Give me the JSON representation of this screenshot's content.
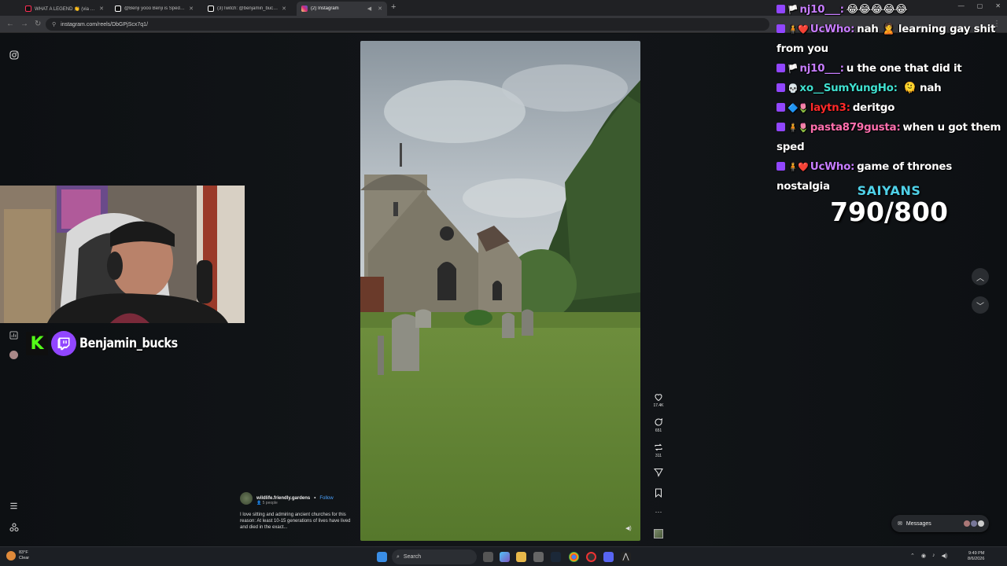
{
  "browser": {
    "tabs": [
      {
        "title": "WHAT A LEGEND 👏 (via @Att...",
        "icon_color": "#ff2d55",
        "active": false
      },
      {
        "title": "@Benji yooo Benji is Sped at le...",
        "icon_color": "#ffffff",
        "active": false
      },
      {
        "title": "(3)Twitch: @benjamin_bucks | #...",
        "icon_color": "#ffffff",
        "active": false
      },
      {
        "title": "(2) Instagram",
        "icon_color": "#e1306c",
        "active": true
      }
    ],
    "url": "instagram.com/reels/DbGPjScx7q1/"
  },
  "streamer": {
    "name": "Benjamin_bucks",
    "kick_letter": "K"
  },
  "reel": {
    "likes": "17.4K",
    "comments": "651",
    "reposts": "311",
    "username": "wildlife.friendly.gardens",
    "follow_label": "Follow",
    "sub_label": "5 people",
    "caption": "I love sitting and admiring ancient churches for this reason: At least 10-15 generations of lives have lived and died in the exact..."
  },
  "chat": {
    "messages": [
      {
        "user": "nj10___:",
        "user_color": "#c77dff",
        "text": "😂😂😂😂😂",
        "icons": "🏳️"
      },
      {
        "user": "UcWho:",
        "user_color": "#c77dff",
        "text": "nah 🙎 learning gay shit from you",
        "icons": "🧍❤️"
      },
      {
        "user": "nj10___:",
        "user_color": "#c77dff",
        "text": "u the one that did it",
        "icons": "🏳️"
      },
      {
        "user": "xo__SumYungHo:",
        "user_color": "#40e0d0",
        "text": " 🫠 nah",
        "icons": "💀"
      },
      {
        "user": "laytn3:",
        "user_color": "#ff2a2a",
        "text": "deritgo",
        "icons": "🔷🌷"
      },
      {
        "user": "pasta879gusta:",
        "user_color": "#ff6fae",
        "text": "when u got them sped",
        "icons": "🧍🌷"
      },
      {
        "user": "UcWho:",
        "user_color": "#c77dff",
        "text": "game of thrones nostalgia",
        "icons": "🧍❤️"
      }
    ]
  },
  "goal": {
    "label": "SAIYANS",
    "value": "790/800"
  },
  "messages_pill": {
    "label": "Messages"
  },
  "taskbar": {
    "search_label": "Search",
    "weather_temp": "83°F",
    "weather_desc": "Clear",
    "time": "9:49 PM",
    "date": "8/6/2026"
  },
  "colors": {
    "twitch": "#9146ff",
    "kick": "#53fc18",
    "goal": "#4fd1e8"
  }
}
